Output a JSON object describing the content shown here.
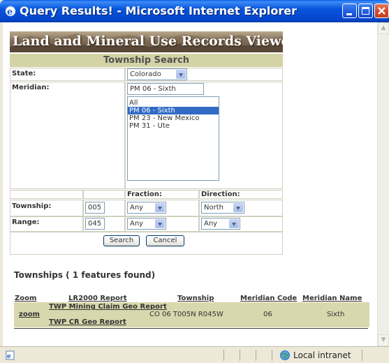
{
  "window": {
    "title": "Query Results! - Microsoft Internet Explorer"
  },
  "banner": {
    "text": "Land and Mineral Use Records Viewer"
  },
  "form": {
    "header": "Township Search",
    "state_label": "State:",
    "state_value": "Colorado",
    "meridian_label": "Meridian:",
    "meridian_value": "PM 06 - Sixth",
    "meridian_options": [
      "All",
      "PM 06 - Sixth",
      "PM 23 - New Mexico",
      "PM 31 - Ute"
    ],
    "meridian_selected_index": 1,
    "fraction_label": "Fraction:",
    "direction_label": "Direction:",
    "township_label": "Township:",
    "township_value": "005",
    "township_fraction": "Any",
    "township_direction": "North",
    "range_label": "Range:",
    "range_value": "045",
    "range_fraction": "Any",
    "range_direction": "Any",
    "search_button": "Search",
    "cancel_button": "Cancel"
  },
  "results": {
    "title": "Townships ( 1 features found)",
    "columns": [
      "Zoom",
      "LR2000 Report",
      "Township",
      "Meridian Code",
      "Meridian Name"
    ],
    "rows": [
      {
        "zoom": "zoom",
        "report_links": [
          "TWP Mining Claim Geo Report",
          "TWP CR Geo Report"
        ],
        "township": "CO 06 T005N R045W",
        "meridian_code": "06",
        "meridian_name": "Sixth"
      }
    ]
  },
  "statusbar": {
    "zone": "Local intranet"
  },
  "colors": {
    "titlebar": "#0a5fe8",
    "section_header": "#d3d3a6",
    "row_bg": "#d8d8ae",
    "selection": "#316ac5"
  }
}
